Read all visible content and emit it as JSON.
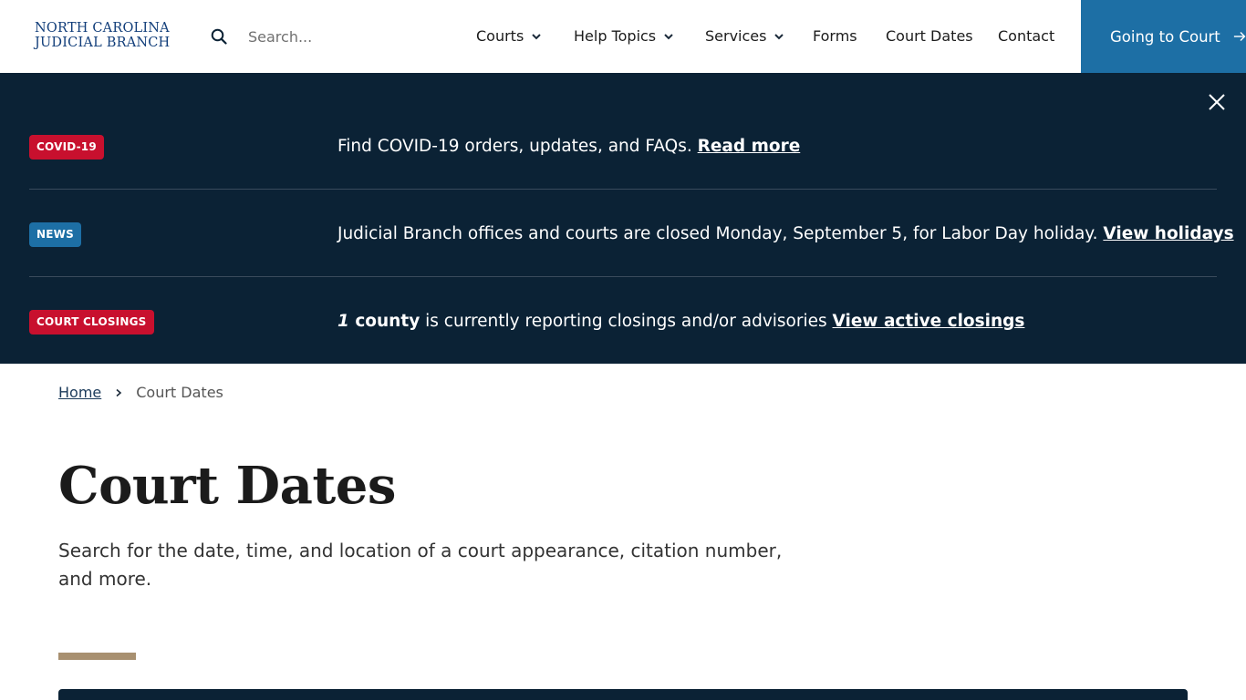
{
  "header": {
    "logo_line1": "NORTH CAROLINA",
    "logo_line2": "JUDICIAL BRANCH",
    "search_placeholder": "Search...",
    "nav": [
      {
        "label": "Courts",
        "dropdown": true
      },
      {
        "label": "Help Topics",
        "dropdown": true
      },
      {
        "label": "Services",
        "dropdown": true
      },
      {
        "label": "Forms",
        "dropdown": false
      },
      {
        "label": "Court Dates",
        "dropdown": false
      },
      {
        "label": "Contact",
        "dropdown": false
      }
    ],
    "cta_label": "Going to Court"
  },
  "alerts": [
    {
      "badge": "COVID-19",
      "badge_color": "#c8102e",
      "text": "Find COVID-19 orders, updates, and FAQs.",
      "link": "Read more"
    },
    {
      "badge": "NEWS",
      "badge_color": "#1d6fa5",
      "text": "Judicial Branch offices and courts are closed Monday, September 5, for Labor Day holiday.",
      "link": "View holidays"
    },
    {
      "badge": "COURT CLOSINGS",
      "badge_color": "#c8102e",
      "count": "1",
      "count_unit": "county",
      "text": "is currently reporting closings and/or advisories",
      "link": "View active closings"
    }
  ],
  "breadcrumb": {
    "home": "Home",
    "current": "Court Dates"
  },
  "page": {
    "title": "Court Dates",
    "description": "Search for the date, time, and location of a court appearance, citation number, and more."
  },
  "colors": {
    "primary_dark": "#0b2235",
    "accent_blue": "#1d6fa5",
    "alert_red": "#c8102e",
    "logo_blue": "#123e7a",
    "accent_tan": "#a89070"
  }
}
